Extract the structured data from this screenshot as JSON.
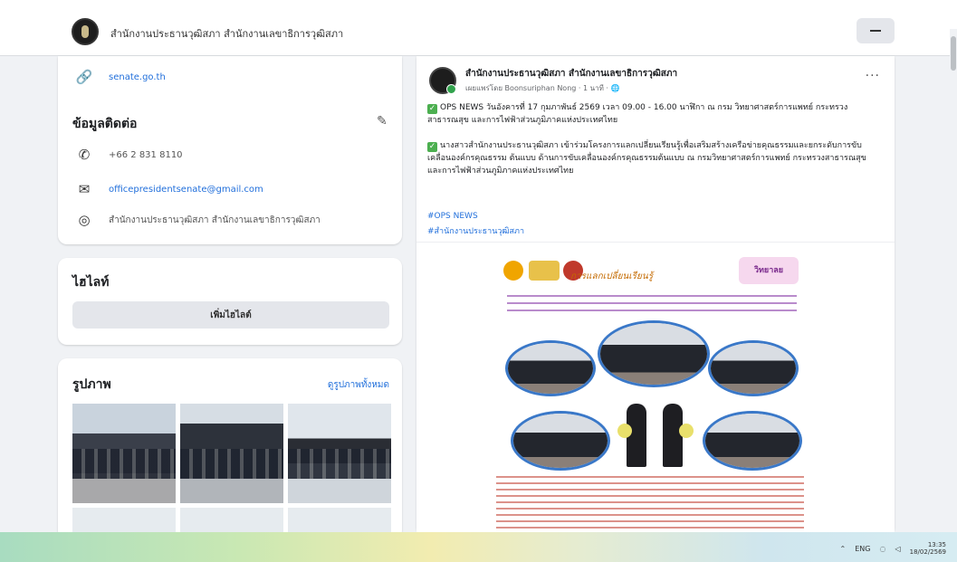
{
  "header": {
    "page_title": "สำนักงานประธานวุฒิสภา สำนักงานเลขาธิการวุฒิสภา"
  },
  "intro": {
    "website": "senate.go.th"
  },
  "contact": {
    "heading": "ข้อมูลติดต่อ",
    "phone": "+66 2 831 8110",
    "email": "officepresidentsenate@gmail.com",
    "messenger": "สำนักงานประธานวุฒิสภา สำนักงานเลขาธิการวุฒิสภา"
  },
  "highlights": {
    "heading": "ไฮไลท์",
    "add_button": "เพิ่มไฮไลต์"
  },
  "photos": {
    "heading": "รูปภาพ",
    "see_all": "ดูรูปภาพทั้งหมด"
  },
  "post": {
    "author": "สำนักงานประธานวุฒิสภา สำนักงานเลขาธิการวุฒิสภา",
    "meta": "เผยแพร่โดย Boonsuriphan Nong · 1 นาที · 🌐",
    "more": "···",
    "para1": "OPS NEWS วันอังคารที่ 17 กุมภาพันธ์ 2569 เวลา 09.00 - 16.00 นาฬิกา ณ กรม วิทยาศาสตร์การแพทย์ กระทรวงสาธารณสุข และการไฟฟ้าส่วนภูมิภาคแห่งประเทศไทย",
    "para2": "นางสาวสำนักงานประธานวุฒิสภา เข้าร่วมโครงการแลกเปลี่ยนเรียนรู้เพื่อเสริมสร้างเครือข่ายคุณธรรมและยกระดับการขับเคลื่อนองค์กรคุณธรรม ต้นแบบ ด้านการขับเคลื่อนองค์กรคุณธรรมต้นแบบ ณ กรมวิทยาศาสตร์การแพทย์ กระทรวงสาธารณสุข และการไฟฟ้าส่วนภูมิภาคแห่งประเทศไทย",
    "hashtag1": "#OPS NEWS",
    "hashtag2": "#สำนักงานประธานวุฒิสภา",
    "flyer_title": "การแลกเปลี่ยนเรียนรู้",
    "flyer_badge": "วิทยาลย"
  },
  "taskbar": {
    "tray_label": "ENG",
    "time": "13:35",
    "date": "18/02/2569"
  },
  "colors": {
    "link": "#216fdb",
    "page_bg": "#f0f2f5"
  }
}
